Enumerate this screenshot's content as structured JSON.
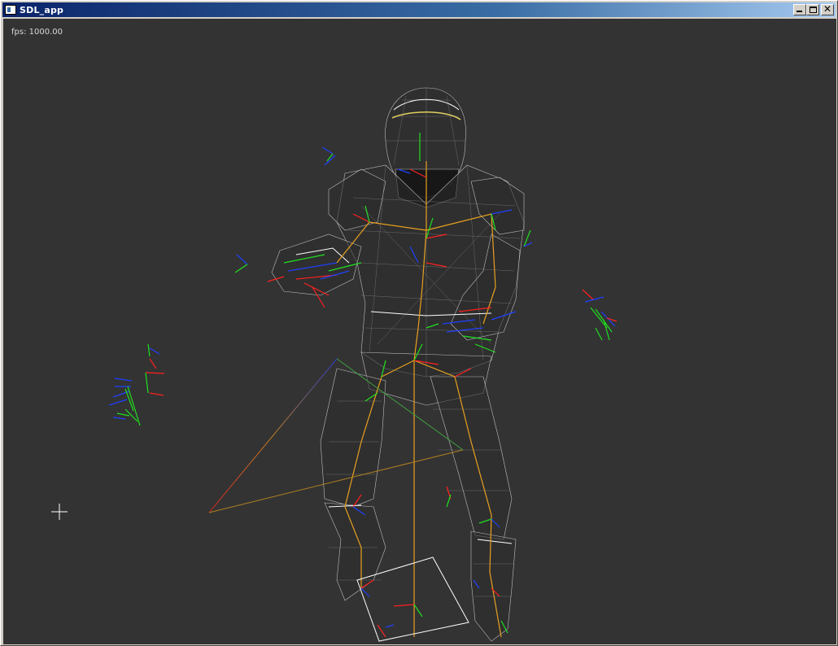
{
  "window": {
    "title": "SDL_app",
    "close_glyph": "✕"
  },
  "viewport": {
    "fps_text": "fps: 1000.00",
    "background": "#333333"
  },
  "icons": {
    "app": "app-window-icon",
    "minimize": "minimize-icon",
    "maximize": "maximize-icon",
    "close": "close-icon",
    "cursor": "crosshair-cursor-icon"
  },
  "colors": {
    "wire": "#c8c8c8",
    "bone": "#e8a020",
    "axis_x": "#ff2020",
    "axis_y": "#20e020",
    "axis_z": "#2040ff"
  }
}
